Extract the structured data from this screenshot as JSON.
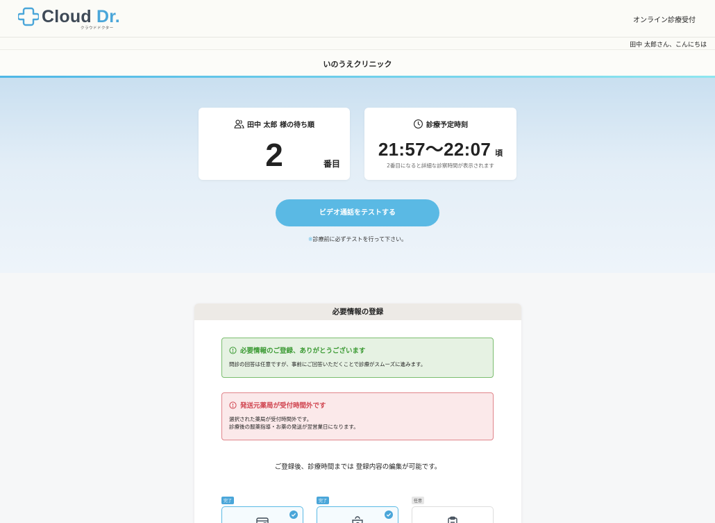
{
  "header": {
    "logo_text_main": "Cloud",
    "logo_text_accent": "Dr.",
    "logo_subtext": "クラウドドクター",
    "online_link": "オンライン診療受付",
    "greeting": "田中 太郎さん、こんにちは"
  },
  "clinic": {
    "name": "いのうえクリニック"
  },
  "waiting_card": {
    "title": "田中 太郎 様の待ち順",
    "number": "2",
    "unit": "番目"
  },
  "time_card": {
    "title": "診療予定時刻",
    "time_range": "21:57～22:07",
    "suffix": "頃",
    "note": "2番目になると詳細な診察時間が表示されます"
  },
  "video_test": {
    "button_label": "ビデオ通話をテストする",
    "note_mark": "※",
    "note": "診療前に必ずテストを行って下さい。"
  },
  "registration": {
    "title": "必要情報の登録",
    "success_alert": {
      "title": "必要情報のご登録、ありがとうございます",
      "body": "問診の回答は任意ですが、事前にご回答いただくことで診療がスムーズに進みます。"
    },
    "error_alert": {
      "title": "発送元薬局が受付時間外です",
      "body_line1": "選択された薬局が受付時間外です。",
      "body_line2": "診療後の服薬指導・お薬の発送が翌営業日になります。"
    },
    "edit_note": "ご登録後、診療時間までは 登録内容の編集が可能です。",
    "steps": [
      {
        "tag": "完了",
        "icon": "id-card-icon",
        "status": "done"
      },
      {
        "tag": "完了",
        "icon": "pharmacy-bag-icon",
        "status": "done"
      },
      {
        "tag": "任意",
        "icon": "clipboard-icon",
        "status": "optional"
      }
    ]
  },
  "colors": {
    "accent": "#4aa6d9",
    "button": "#5ab9e4",
    "success": "#3b9a33",
    "error": "#d04550"
  }
}
